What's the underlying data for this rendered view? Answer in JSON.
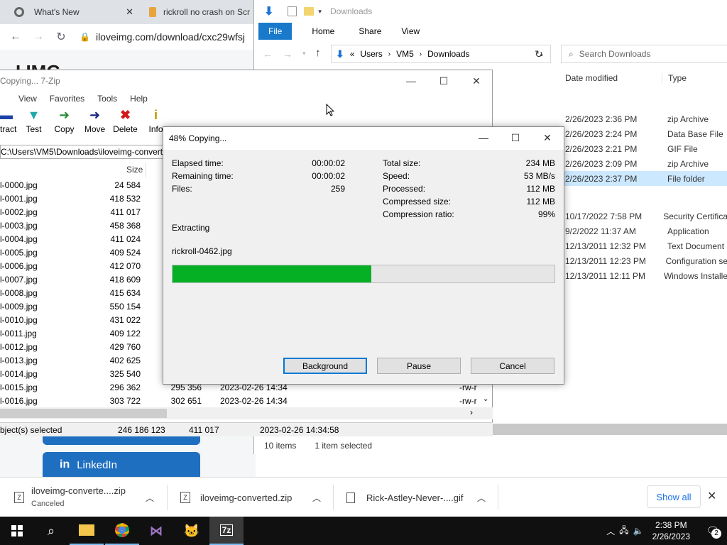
{
  "chrome": {
    "tabs": [
      {
        "label": "What's New"
      },
      {
        "label": "rickroll no crash on Scr"
      }
    ],
    "url": "iloveimg.com/download/cxc29wfsj",
    "logo_text": "I  IMG",
    "linkedin_label": "LinkedIn"
  },
  "explorer": {
    "title": "Downloads",
    "ribbon_tabs": [
      "File",
      "Home",
      "Share",
      "View"
    ],
    "breadcrumb": [
      "Users",
      "VM5",
      "Downloads"
    ],
    "breadcrumb_prefix": "«",
    "search_placeholder": "Search Downloads",
    "col_date": "Date modified",
    "col_type": "Type",
    "rows": [
      {
        "date": "2/26/2023 2:36 PM",
        "type": "zip Archive"
      },
      {
        "date": "2/26/2023 2:24 PM",
        "type": "Data Base File"
      },
      {
        "date": "2/26/2023 2:21 PM",
        "type": "GIF File"
      },
      {
        "date": "2/26/2023 2:09 PM",
        "type": "zip Archive"
      },
      {
        "date": "2/26/2023 2:37 PM",
        "type": "File folder"
      },
      {
        "date": "10/17/2022 7:58 PM",
        "type": "Security Certifica"
      },
      {
        "date": "9/2/2022 11:37 AM",
        "type": "Application"
      },
      {
        "date": "12/13/2011 12:32 PM",
        "type": "Text Document"
      },
      {
        "date": "12/13/2011 12:23 PM",
        "type": "Configuration se"
      },
      {
        "date": "12/13/2011 12:11 PM",
        "type": "Windows Installe"
      }
    ],
    "status_items": "10 items",
    "status_selected": "1 item selected"
  },
  "zip": {
    "title": "Copying... 7-Zip",
    "menu": [
      "",
      "View",
      "Favorites",
      "Tools",
      "Help"
    ],
    "toolbar": [
      "tract",
      "Test",
      "Copy",
      "Move",
      "Delete",
      "Info"
    ],
    "path": "C:\\Users\\VM5\\Downloads\\iloveimg-convert",
    "col_size": "Size",
    "files": [
      {
        "name": "l-0000.jpg",
        "size": "24 584"
      },
      {
        "name": "l-0001.jpg",
        "size": "418 532"
      },
      {
        "name": "l-0002.jpg",
        "size": "411 017"
      },
      {
        "name": "l-0003.jpg",
        "size": "458 368"
      },
      {
        "name": "l-0004.jpg",
        "size": "411 024"
      },
      {
        "name": "l-0005.jpg",
        "size": "409 524"
      },
      {
        "name": "l-0006.jpg",
        "size": "412 070"
      },
      {
        "name": "l-0007.jpg",
        "size": "418 609"
      },
      {
        "name": "l-0008.jpg",
        "size": "415 634"
      },
      {
        "name": "l-0009.jpg",
        "size": "550 154"
      },
      {
        "name": "l-0010.jpg",
        "size": "431 022"
      },
      {
        "name": "l-0011.jpg",
        "size": "409 122"
      },
      {
        "name": "l-0012.jpg",
        "size": "429 760"
      },
      {
        "name": "l-0013.jpg",
        "size": "402 625"
      },
      {
        "name": "l-0014.jpg",
        "size": "325 540"
      },
      {
        "name": "l-0015.jpg",
        "size": "296 362",
        "packed": "295 356",
        "modified": "2023-02-26 14:34",
        "attr": "-rw-r"
      },
      {
        "name": "l-0016.jpg",
        "size": "303 722",
        "packed": "302 651",
        "modified": "2023-02-26 14:34",
        "attr": "-rw-r"
      }
    ],
    "status": {
      "selected": "bject(s) selected",
      "total": "246 186 123",
      "size": "411 017",
      "date": "2023-02-26 14:34:58"
    }
  },
  "dialog": {
    "title": "48% Copying...",
    "progress": 0.52,
    "left": [
      {
        "k": "Elapsed time:",
        "v": "00:00:02"
      },
      {
        "k": "Remaining time:",
        "v": "00:00:02"
      },
      {
        "k": "Files:",
        "v": "259"
      }
    ],
    "right": [
      {
        "k": "Total size:",
        "v": "234 MB"
      },
      {
        "k": "Speed:",
        "v": "53 MB/s"
      },
      {
        "k": "Processed:",
        "v": "112 MB"
      },
      {
        "k": "Compressed size:",
        "v": "112 MB"
      },
      {
        "k": "Compression ratio:",
        "v": "99%"
      }
    ],
    "operation": "Extracting",
    "current_file": "rickroll-0462.jpg",
    "buttons": {
      "background": "Background",
      "pause": "Pause",
      "cancel": "Cancel"
    }
  },
  "downloads": {
    "items": [
      {
        "name": "iloveimg-converte....zip",
        "status": "Canceled"
      },
      {
        "name": "iloveimg-converted.zip"
      },
      {
        "name": "Rick-Astley-Never-....gif"
      }
    ],
    "show_all": "Show all"
  },
  "taskbar": {
    "time": "2:38 PM",
    "date": "2/26/2023",
    "notification_count": "2"
  },
  "colors": {
    "progress_fill": "#06b025",
    "ribbon_active": "#1979ca",
    "selected_row": "#cce8ff",
    "linkedin": "#1f6fc1"
  }
}
